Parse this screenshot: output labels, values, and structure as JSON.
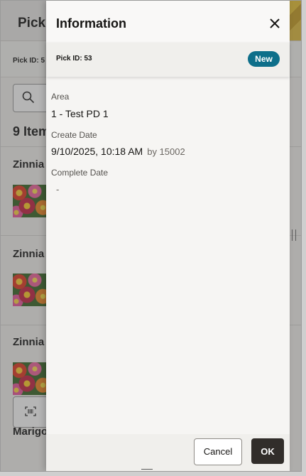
{
  "background": {
    "title": "Pick",
    "pick_id": "Pick ID: 5",
    "item_count": "9 Item",
    "items": [
      {
        "name": "Zinnia"
      },
      {
        "name": "Zinnia"
      },
      {
        "name": "Zinnia"
      }
    ],
    "last_item": "Marigo"
  },
  "drawer": {
    "title": "Information",
    "pick_id": "Pick ID: 53",
    "status": "New",
    "fields": {
      "area_label": "Area",
      "area_value": "1 - Test PD 1",
      "create_date_label": "Create Date",
      "create_date_value": "9/10/2025, 10:18 AM",
      "create_by": "by 15002",
      "complete_date_label": "Complete Date",
      "complete_date_value": "-"
    },
    "footer": {
      "cancel_label": "Cancel",
      "ok_label": "OK"
    }
  },
  "colors": {
    "badge": "#0e6f8a",
    "ok_button": "#312d2a"
  }
}
